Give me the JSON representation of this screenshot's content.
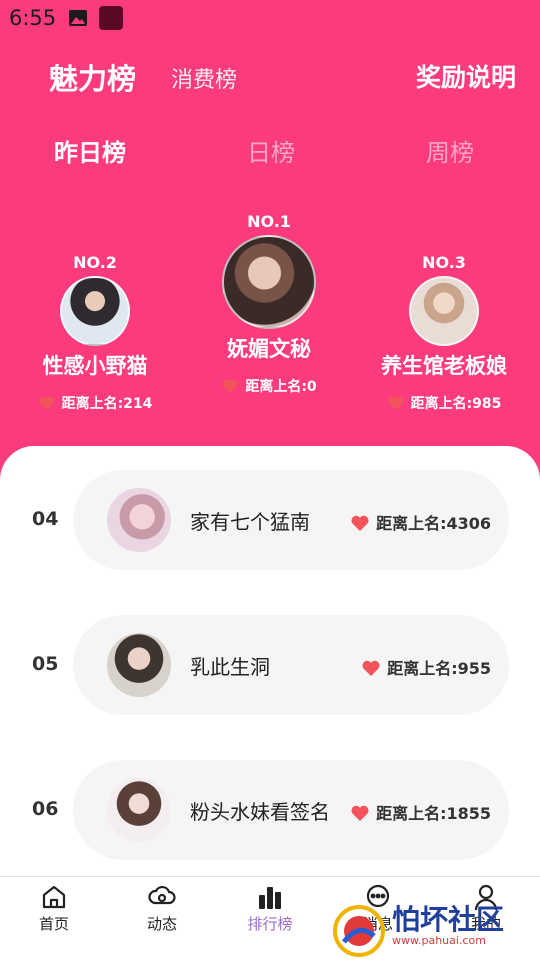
{
  "status": {
    "time": "6:55"
  },
  "header": {
    "board_tabs": [
      "魅力榜",
      "消费榜"
    ],
    "reward_link": "奖励说明",
    "period_tabs": [
      "昨日榜",
      "日榜",
      "周榜"
    ]
  },
  "podium": {
    "first": {
      "rank": "NO.1",
      "name": "妩媚文秘",
      "distance": "距离上名:0"
    },
    "second": {
      "rank": "NO.2",
      "name": "性感小野猫",
      "distance": "距离上名:214"
    },
    "third": {
      "rank": "NO.3",
      "name": "养生馆老板娘",
      "distance": "距离上名:985"
    }
  },
  "list": [
    {
      "rank": "04",
      "name": "家有七个猛南",
      "distance": "距离上名:4306"
    },
    {
      "rank": "05",
      "name": "乳此生洞",
      "distance": "距离上名:955"
    },
    {
      "rank": "06",
      "name": "粉头水妹看签名",
      "distance": "距离上名:1855"
    }
  ],
  "nav": [
    "首页",
    "动态",
    "排行榜",
    "消息",
    "我的"
  ],
  "watermark": {
    "text": "怕坏社区",
    "url": "www.pahuai.com"
  },
  "colors": {
    "brand": "#fb3b7e",
    "heart": "#f2545b",
    "active_nav": "#9b6ad2"
  }
}
